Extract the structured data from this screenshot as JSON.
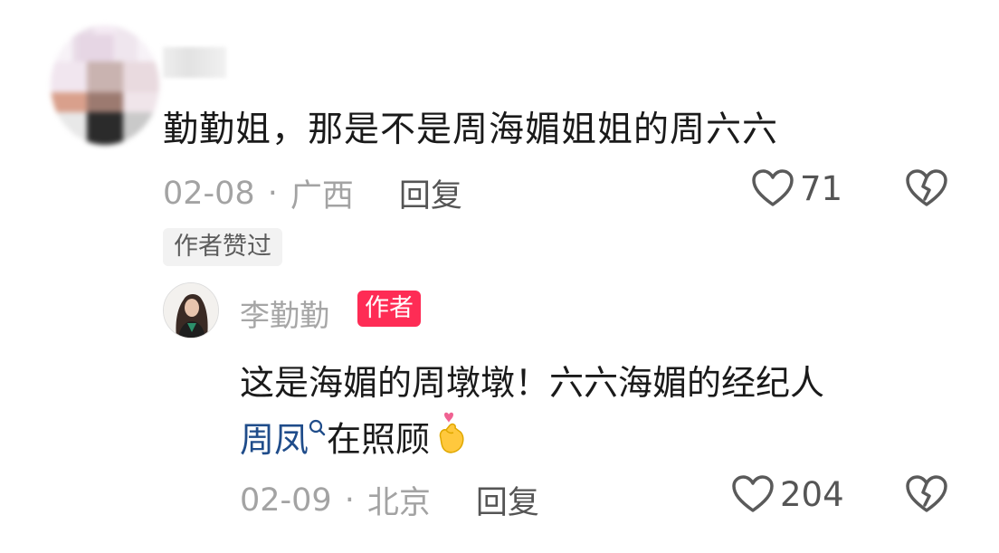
{
  "comment_main": {
    "text": "勤勤姐，那是不是周海媚姐姐的周六六",
    "date": "02-08",
    "separator": "·",
    "location": "广西",
    "reply_label": "回复",
    "likes": "71",
    "author_liked_label": "作者赞过"
  },
  "comment_reply": {
    "username": "李勤勤",
    "author_badge": "作者",
    "text_line1": "这是海媚的周墩墩！六六海媚的经纪人",
    "mention": "周凤",
    "text_line2_after": "在照顾",
    "date": "02-09",
    "separator": "·",
    "location": "北京",
    "reply_label": "回复",
    "likes": "204"
  },
  "colors": {
    "badge": "#fe2c55",
    "mention": "#1f4c8a",
    "meta": "#a3a3a3"
  },
  "icons": {
    "like": "heart-outline-icon",
    "dislike": "broken-heart-icon",
    "search": "search-icon",
    "emoji": "finger-heart-emoji"
  }
}
